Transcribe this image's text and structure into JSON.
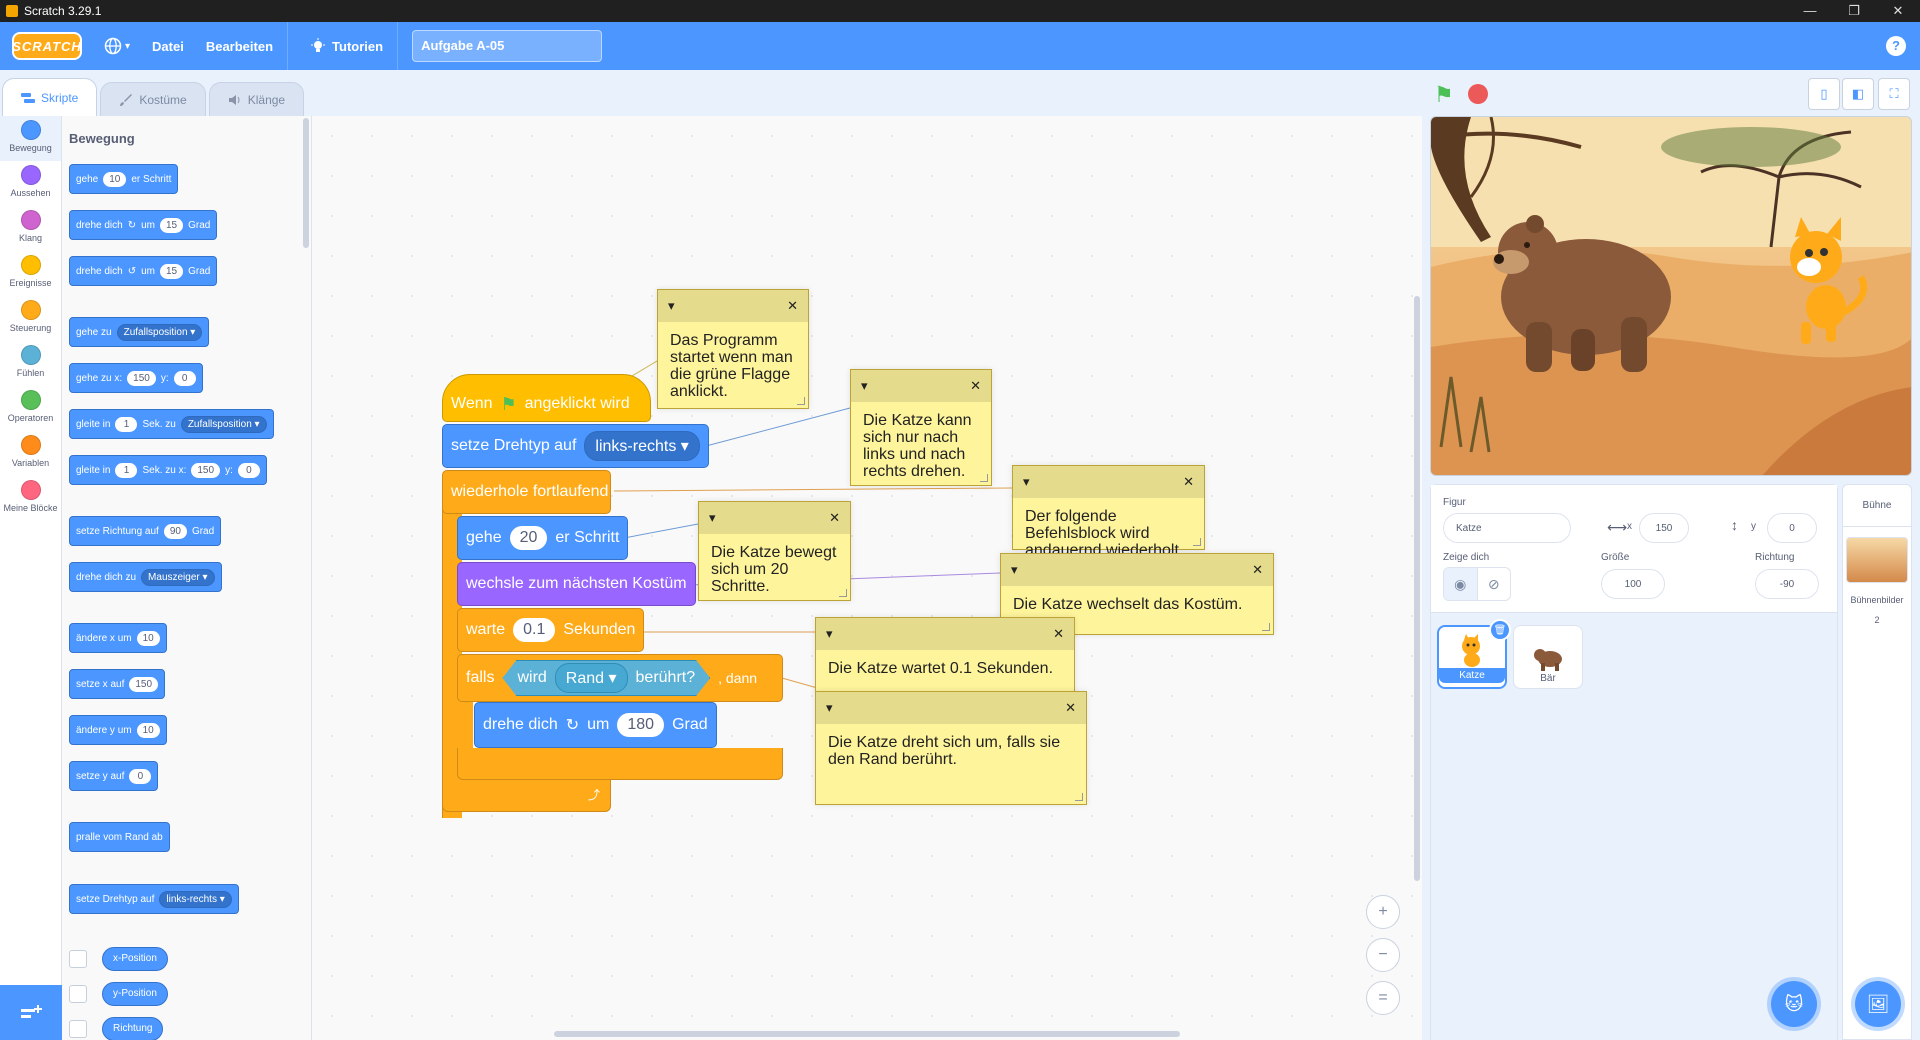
{
  "window": {
    "title": "Scratch 3.29.1",
    "controls": [
      "—",
      "❐",
      "✕"
    ]
  },
  "menubar": {
    "logo": "SCRATCH",
    "globe_caret": "▾",
    "file": "Datei",
    "edit": "Bearbeiten",
    "tutorials": "Tutorien",
    "project_title": "Aufgabe A-05",
    "help": "?"
  },
  "tabs": {
    "code": "Skripte",
    "costumes": "Kostüme",
    "sounds": "Klänge"
  },
  "categories": [
    {
      "label": "Bewegung",
      "color": "#4c97ff"
    },
    {
      "label": "Aussehen",
      "color": "#9966ff"
    },
    {
      "label": "Klang",
      "color": "#cf63cf"
    },
    {
      "label": "Ereignisse",
      "color": "#ffbf00"
    },
    {
      "label": "Steuerung",
      "color": "#ffab19"
    },
    {
      "label": "Fühlen",
      "color": "#5cb1d6"
    },
    {
      "label": "Operatoren",
      "color": "#59c059"
    },
    {
      "label": "Variablen",
      "color": "#ff8c1a"
    },
    {
      "label": "Meine Blöcke",
      "color": "#ff6680"
    }
  ],
  "palette": {
    "heading": "Bewegung",
    "move": {
      "a": "gehe",
      "v": "10",
      "b": "er Schritt"
    },
    "turn_right": {
      "a": "drehe dich",
      "b": "um",
      "v": "15",
      "c": "Grad"
    },
    "turn_left": {
      "a": "drehe dich",
      "b": "um",
      "v": "15",
      "c": "Grad"
    },
    "goto": {
      "a": "gehe zu",
      "v": "Zufallsposition"
    },
    "goto_xy": {
      "a": "gehe zu x:",
      "x": "150",
      "b": "y:",
      "y": "0"
    },
    "glide_to": {
      "a": "gleite in",
      "v": "1",
      "b": "Sek. zu",
      "t": "Zufallsposition"
    },
    "glide_xy": {
      "a": "gleite in",
      "v": "1",
      "b": "Sek. zu x:",
      "x": "150",
      "c": "y:",
      "y": "0"
    },
    "point_dir": {
      "a": "setze Richtung auf",
      "v": "90",
      "b": "Grad"
    },
    "point_to": {
      "a": "drehe dich zu",
      "v": "Mauszeiger"
    },
    "change_x": {
      "a": "ändere x um",
      "v": "10"
    },
    "set_x": {
      "a": "setze x auf",
      "v": "150"
    },
    "change_y": {
      "a": "ändere y um",
      "v": "10"
    },
    "set_y": {
      "a": "setze y auf",
      "v": "0"
    },
    "bounce": "pralle vom Rand ab",
    "rotation": {
      "a": "setze Drehtyp auf",
      "v": "links-rechts"
    },
    "reporters": [
      "x-Position",
      "y-Position",
      "Richtung"
    ]
  },
  "script": {
    "hat": {
      "a": "Wenn",
      "b": "angeklickt wird"
    },
    "rot": {
      "a": "setze Drehtyp auf",
      "v": "links-rechts"
    },
    "forever": "wiederhole fortlaufend",
    "move": {
      "a": "gehe",
      "v": "20",
      "b": "er Schritt"
    },
    "costume": "wechsle zum nächsten Kostüm",
    "wait": {
      "a": "warte",
      "v": "0.1",
      "b": "Sekunden"
    },
    "ifblk": {
      "a": "falls",
      "b": "wird",
      "v": "Rand",
      "c": "berührt?",
      "d": ", dann"
    },
    "turn": {
      "a": "drehe dich",
      "b": "um",
      "v": "180",
      "c": "Grad"
    }
  },
  "comments": [
    "Das Programm startet wenn man die grüne Flagge anklickt.",
    "Die Katze kann sich nur nach links und nach rechts drehen.",
    "Der folgende Befehlsblock wird andauernd wiederholt.",
    "Die Katze bewegt sich um 20 Schritte.",
    "Die Katze wechselt das Kostüm.",
    "Die Katze wartet 0.1 Sekunden.",
    "Die Katze dreht sich um, falls sie den Rand berührt."
  ],
  "sprite_info": {
    "sprite_label": "Figur",
    "sprite_name": "Katze",
    "x_label": "x",
    "x": "150",
    "y_label": "y",
    "y": "0",
    "show_label": "Zeige dich",
    "size_label": "Größe",
    "size": "100",
    "direction_label": "Richtung",
    "direction": "-90"
  },
  "sprites": [
    "Katze",
    "Bär"
  ],
  "stage_pane": {
    "title": "Bühne",
    "backdrops_label": "Bühnenbilder",
    "backdrops_count": "2"
  },
  "zoom": {
    "in": "+",
    "out": "−",
    "reset": "="
  }
}
